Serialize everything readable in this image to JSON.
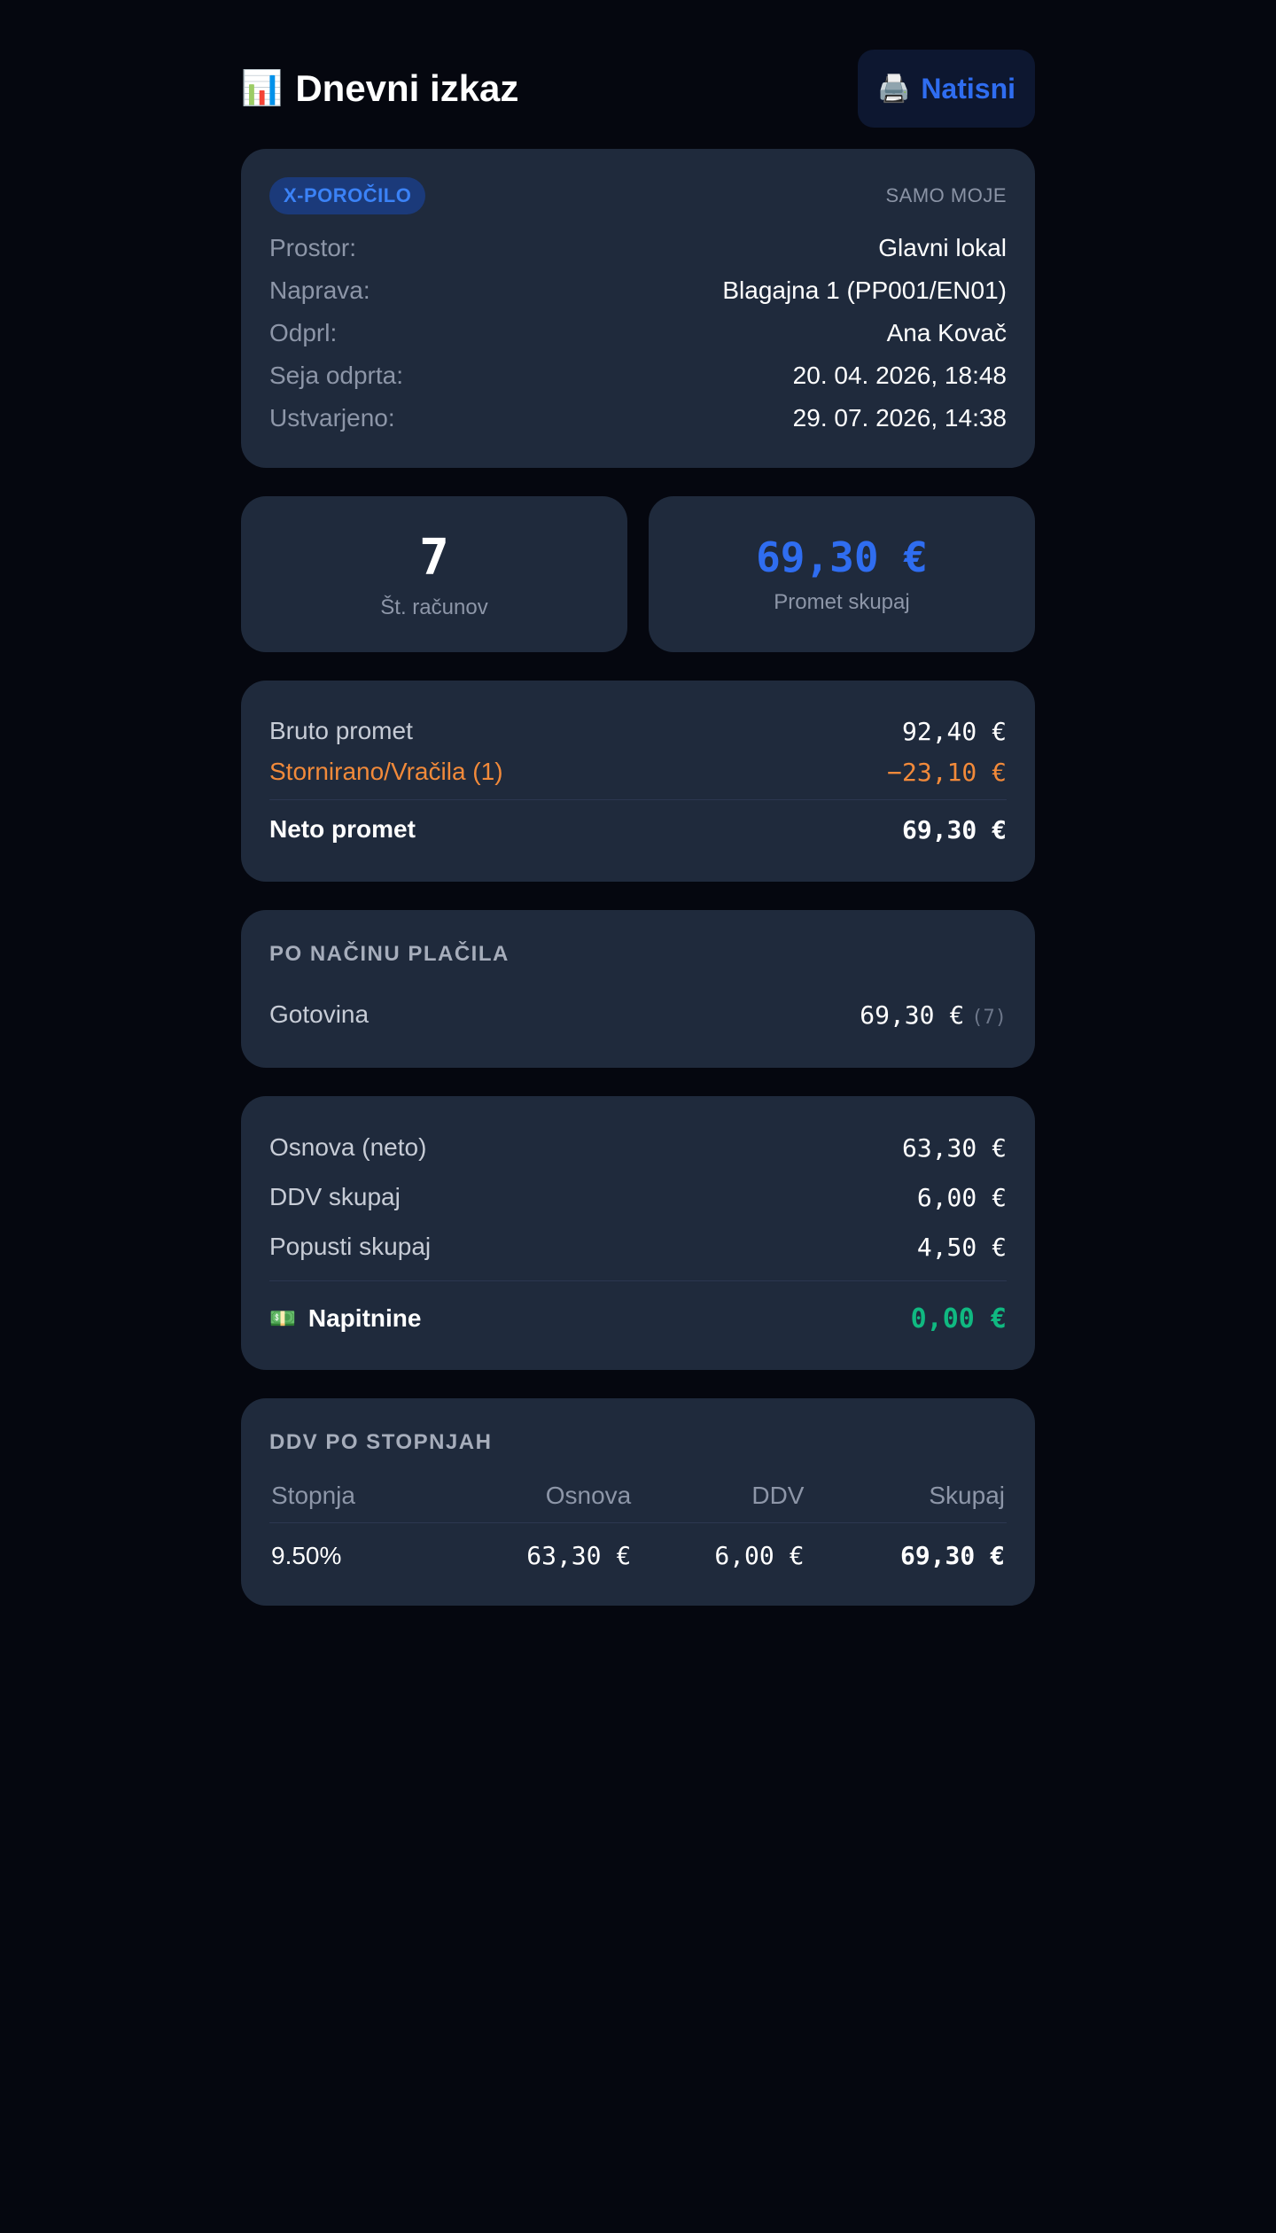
{
  "header": {
    "title": "Dnevni izkaz",
    "title_icon": "📊",
    "print_icon": "🖨️",
    "print_label": "Natisni"
  },
  "info": {
    "badge": "X-POROČILO",
    "scope": "SAMO MOJE",
    "rows": [
      {
        "label": "Prostor:",
        "value": "Glavni lokal"
      },
      {
        "label": "Naprava:",
        "value": "Blagajna 1 (PP001/EN01)"
      },
      {
        "label": "Odprl:",
        "value": "Ana Kovač"
      },
      {
        "label": "Seja odprta:",
        "value": "20. 04. 2026, 18:48"
      },
      {
        "label": "Ustvarjeno:",
        "value": "29. 07. 2026, 14:38"
      }
    ]
  },
  "stats": {
    "receipts_count": "7",
    "receipts_label": "Št. računov",
    "total": "69,30 €",
    "total_label": "Promet skupaj"
  },
  "turnover": {
    "gross_label": "Bruto promet",
    "gross_value": "92,40 €",
    "voided_label": "Stornirano/Vračila (1)",
    "voided_value": "−23,10 €",
    "net_label": "Neto promet",
    "net_value": "69,30 €"
  },
  "payments": {
    "title": "PO NAČINU PLAČILA",
    "items": [
      {
        "label": "Gotovina",
        "value": "69,30 €",
        "count": "(7)"
      }
    ]
  },
  "totals": {
    "base_label": "Osnova (neto)",
    "base_value": "63,30 €",
    "vat_label": "DDV skupaj",
    "vat_value": "6,00 €",
    "discounts_label": "Popusti skupaj",
    "discounts_value": "4,50 €",
    "tips_icon": "💵",
    "tips_label": "Napitnine",
    "tips_value": "0,00 €"
  },
  "vat_table": {
    "title": "DDV PO STOPNJAH",
    "headers": [
      "Stopnja",
      "Osnova",
      "DDV",
      "Skupaj"
    ],
    "rows": [
      [
        "9.50%",
        "63,30 €",
        "6,00 €",
        "69,30 €"
      ]
    ]
  },
  "colors": {
    "background": "#05070f",
    "card": "#1f2a3c",
    "accent": "#2f6df0",
    "warning": "#f28a3a",
    "success": "#10b981"
  }
}
